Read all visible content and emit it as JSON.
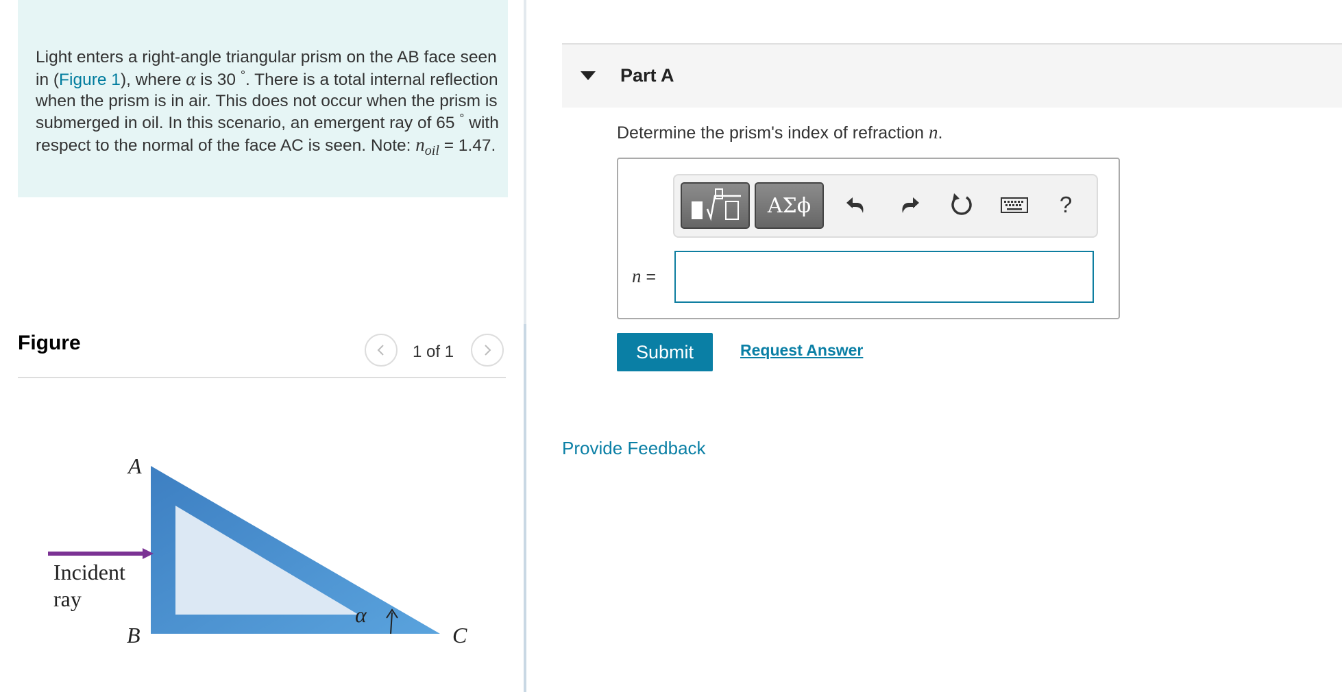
{
  "problem": {
    "t1": "Light enters a right-angle triangular prism on the AB face seen in (",
    "figure_link": "Figure 1",
    "t2": "), where ",
    "alpha_symbol": "α",
    "t3": " is 30 ",
    "degree": "°",
    "t4": ". There is a total internal reflection when the prism is in air. This does not occur when the prism is submerged in oil. In this scenario, an emergent ray of 65 ",
    "t5": " with respect to the normal of the face AC is seen. Note: ",
    "n_symbol": "n",
    "oil_subscript": "oil",
    "t6": " = 1.47."
  },
  "figure_panel": {
    "title": "Figure",
    "counter": "1 of 1",
    "labels": {
      "vertex_a": "A",
      "vertex_b": "B",
      "vertex_c": "C",
      "incident_line1": "Incident",
      "incident_line2": "ray",
      "angle": "α"
    }
  },
  "part": {
    "title": "Part A",
    "question_text": "Determine the prism's index of refraction ",
    "question_symbol": "n",
    "question_end": ".",
    "toolbar": {
      "greek_label": "ΑΣϕ",
      "help_label": "?"
    },
    "input_label_symbol": "n",
    "input_label_eq": " =",
    "input_value": "",
    "submit_label": "Submit",
    "request_answer_label": "Request Answer"
  },
  "feedback_label": "Provide Feedback",
  "colors": {
    "accent": "#0a7fa5",
    "problem_bg": "#e6f5f5",
    "prism_fill": "#dce8f4",
    "prism_edge": "#4d94d1",
    "ray": "#7b3294"
  },
  "icons": [
    "chevron-left-icon",
    "chevron-right-icon",
    "collapse-triangle-icon",
    "templates-icon",
    "undo-icon",
    "redo-icon",
    "reset-icon",
    "keyboard-icon"
  ]
}
